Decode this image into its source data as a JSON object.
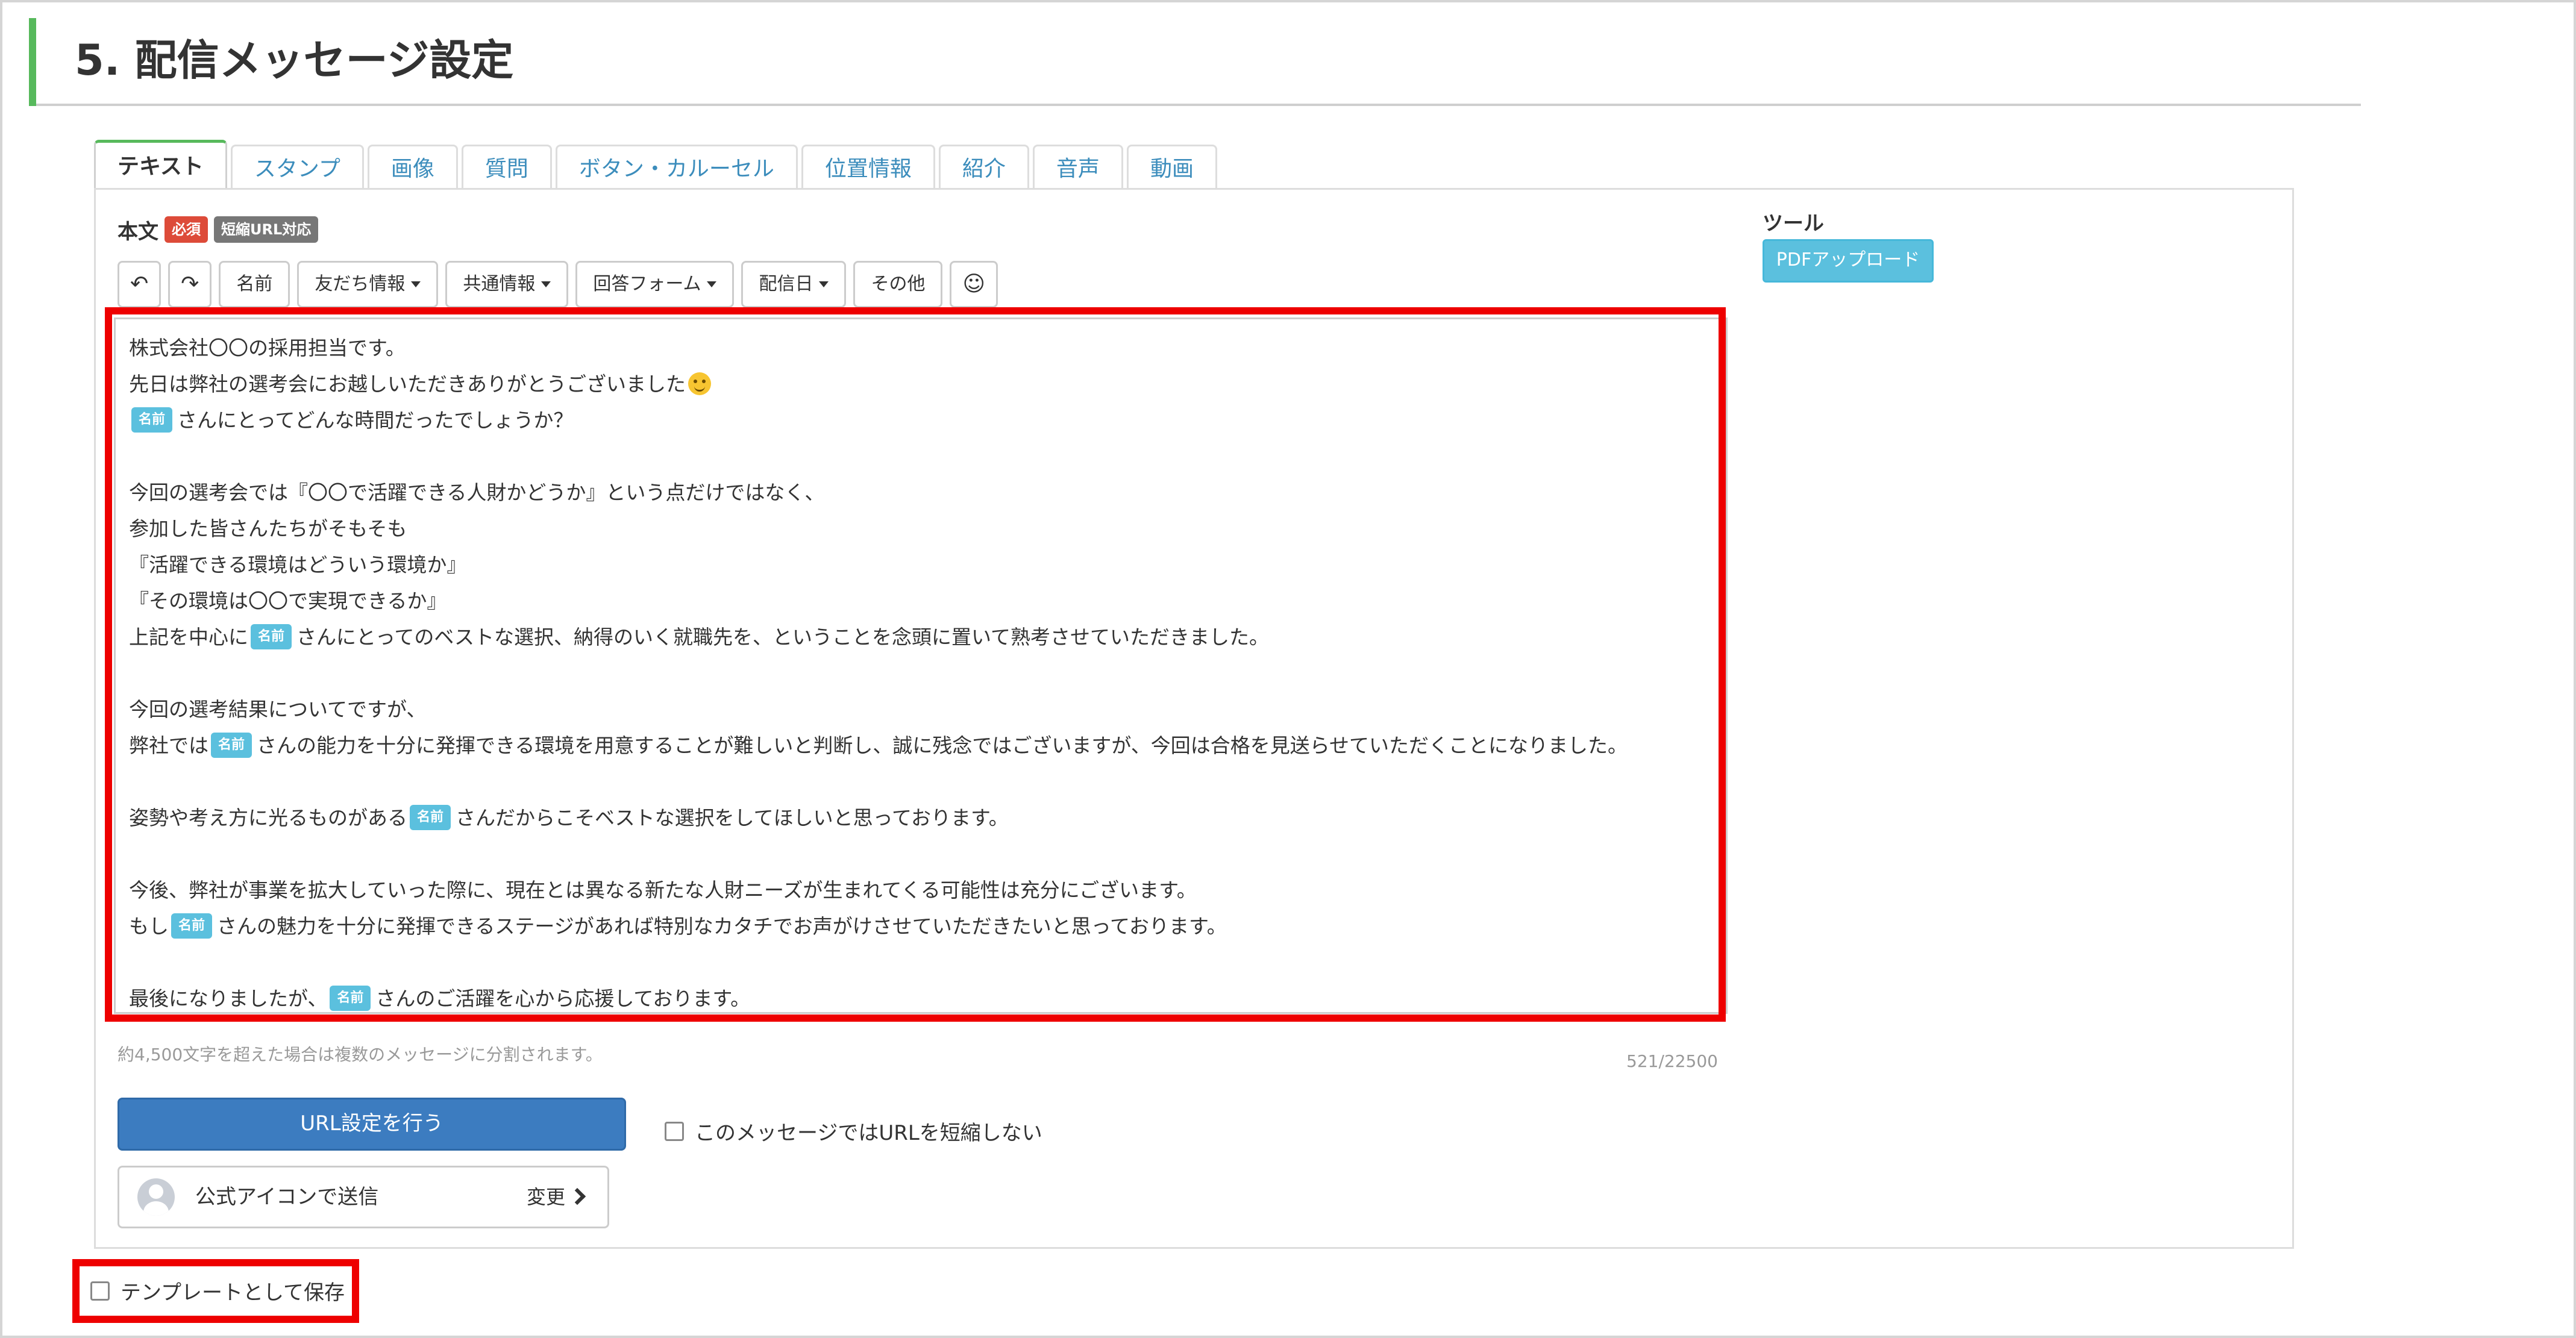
{
  "section": {
    "title": "5. 配信メッセージ設定"
  },
  "tabs": [
    {
      "label": "テキスト",
      "active": true
    },
    {
      "label": "スタンプ"
    },
    {
      "label": "画像"
    },
    {
      "label": "質問"
    },
    {
      "label": "ボタン・カルーセル"
    },
    {
      "label": "位置情報"
    },
    {
      "label": "紹介"
    },
    {
      "label": "音声"
    },
    {
      "label": "動画"
    }
  ],
  "body": {
    "label": "本文",
    "badge_required": "必須",
    "badge_short_url": "短縮URL対応"
  },
  "toolbar": {
    "undo_icon": "↶",
    "redo_icon": "↷",
    "name": "名前",
    "friend_info": "友だち情報",
    "common_info": "共通情報",
    "answer_form": "回答フォーム",
    "delivery_date": "配信日",
    "other": "その他",
    "emoji_icon": "☺"
  },
  "editor": {
    "name_chip": "名前",
    "lines": {
      "l1": "株式会社〇〇の採用担当です。",
      "l2": "先日は弊社の選考会にお越しいただきありがとうございました",
      "l3_after": "さんにとってどんな時間だったでしょうか？",
      "l5": "今回の選考会では『〇〇で活躍できる人財かどうか』という点だけではなく、",
      "l6": "参加した皆さんたちがそもそも",
      "l7": "『活躍できる環境はどういう環境か』",
      "l8": "『その環境は〇〇で実現できるか』",
      "l9_before": "上記を中心に",
      "l9_after": "さんにとってのベストな選択、納得のいく就職先を、ということを念頭に置いて熟考させていただきました。",
      "l11": "今回の選考結果についてですが、",
      "l12_before": "弊社では",
      "l12_after": "さんの能力を十分に発揮できる環境を用意することが難しいと判断し、誠に残念ではございますが、今回は合格を見送らせていただくことになりました。",
      "l14_before": "姿勢や考え方に光るものがある",
      "l14_after": "さんだからこそベストな選択をしてほしいと思っております。",
      "l16": "今後、弊社が事業を拡大していった際に、現在とは異なる新たな人財ニーズが生まれてくる可能性は充分にございます。",
      "l17_before": "もし",
      "l17_after": "さんの魅力を十分に発揮できるステージがあれば特別なカタチでお声がけさせていただきたいと思っております。",
      "l19_before": "最後になりましたが、",
      "l19_after": "さんのご活躍を心から応援しております。"
    }
  },
  "hint": "約4,500文字を超えた場合は複数のメッセージに分割されます。",
  "counter": "521/22500",
  "url_button": "URL設定を行う",
  "no_shorten_checkbox": "このメッセージではURLを短縮しない",
  "sender": {
    "name": "公式アイコンで送信",
    "change": "変更"
  },
  "tools": {
    "label": "ツール",
    "pdf_upload": "PDFアップロード"
  },
  "save_template": "テンプレートとして保存",
  "colors": {
    "accent_green": "#57b95c",
    "link_blue": "#3c8dbc",
    "chip_cyan": "#5bc0de",
    "highlight_red": "#ee0000",
    "primary_button": "#3c7cc0"
  }
}
